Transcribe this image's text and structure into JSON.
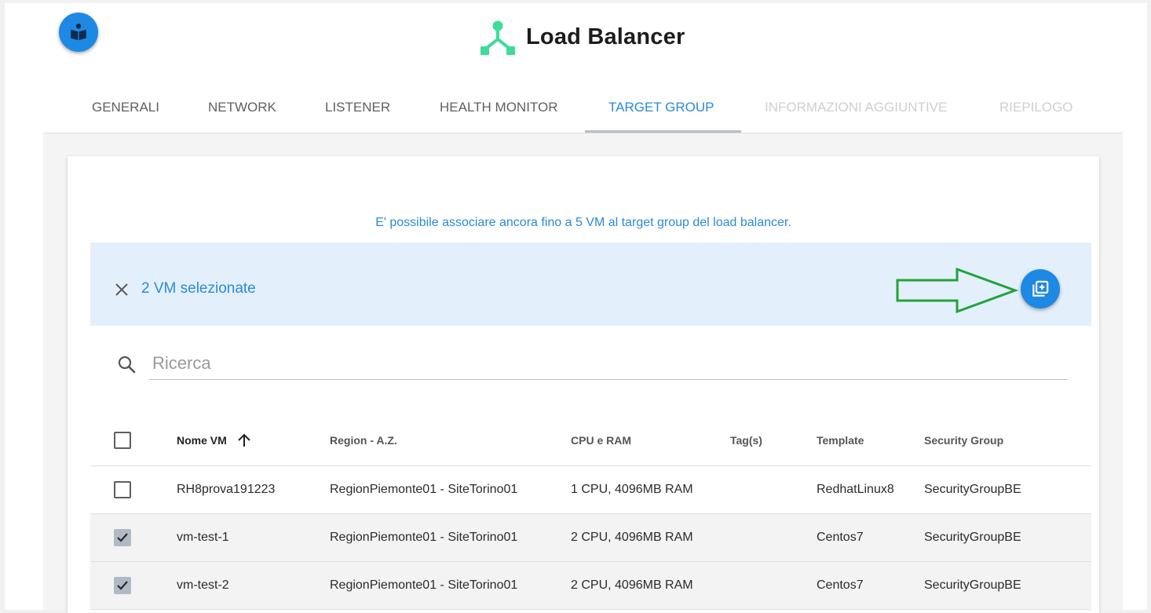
{
  "header": {
    "title": "Load Balancer",
    "help_icon": "book-reader-icon",
    "logo_icon": "load-balancer-logo-icon",
    "logo_color": "#3ddc97"
  },
  "stepper": {
    "steps": [
      {
        "label": "GENERALI",
        "state": "done"
      },
      {
        "label": "NETWORK",
        "state": "done"
      },
      {
        "label": "LISTENER",
        "state": "done"
      },
      {
        "label": "HEALTH MONITOR",
        "state": "done"
      },
      {
        "label": "TARGET GROUP",
        "state": "active"
      },
      {
        "label": "INFORMAZIONI AGGIUNTIVE",
        "state": "disabled"
      },
      {
        "label": "RIEPILOGO",
        "state": "disabled"
      }
    ]
  },
  "target_group": {
    "info": "E' possibile associare ancora fino a 5 VM al target group del load balancer.",
    "selection": {
      "count_label": "2 VM selezionate",
      "close_icon": "close-icon",
      "add_icon": "add-to-group-icon",
      "hint_arrow_color": "#22a33a"
    },
    "search": {
      "placeholder": "Ricerca",
      "value": "",
      "icon": "search-icon"
    },
    "table": {
      "columns": [
        "Nome VM",
        "Region - A.Z.",
        "CPU e RAM",
        "Tag(s)",
        "Template",
        "Security Group"
      ],
      "sort_column": "Nome VM",
      "sort_direction": "ascending",
      "rows": [
        {
          "selected": false,
          "name": "RH8prova191223",
          "region": "RegionPiemonte01 - SiteTorino01",
          "cpu_ram": "1 CPU, 4096MB RAM",
          "tags": "",
          "template": "RedhatLinux8",
          "security_group": "SecurityGroupBE"
        },
        {
          "selected": true,
          "name": "vm-test-1",
          "region": "RegionPiemonte01 - SiteTorino01",
          "cpu_ram": "2 CPU, 4096MB RAM",
          "tags": "",
          "template": "Centos7",
          "security_group": "SecurityGroupBE"
        },
        {
          "selected": true,
          "name": "vm-test-2",
          "region": "RegionPiemonte01 - SiteTorino01",
          "cpu_ram": "2 CPU, 4096MB RAM",
          "tags": "",
          "template": "Centos7",
          "security_group": "SecurityGroupBE"
        }
      ]
    }
  },
  "colors": {
    "accent": "#1e88e5",
    "accent_text": "#2b8ad8",
    "selection_bg": "#e3f0fb",
    "disabled_text": "#cfcfcf"
  }
}
